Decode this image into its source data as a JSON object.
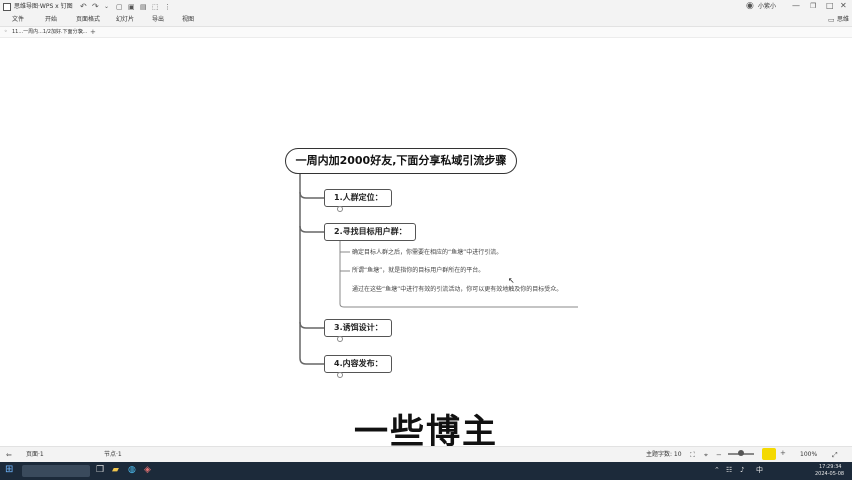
{
  "titlebar": {
    "app_title": "思维导图·WPS x 钉图",
    "user_name": "小紫小",
    "undo_icon": "undo-icon",
    "redo_icon": "redo-icon"
  },
  "menubar": {
    "items": [
      "文件",
      "开始",
      "页面格式",
      "幻灯片",
      "导出",
      "视图"
    ],
    "right_label": "思维"
  },
  "tabbar": {
    "tab_label": "11...一周内...1/2加好.下面分享...",
    "add_icon": "plus-icon"
  },
  "mindmap": {
    "root": "一周内加2000好友,下面分享私域引流步骤",
    "branches": [
      {
        "label": "1.人群定位：",
        "children": []
      },
      {
        "label": "2.寻找目标用户群：",
        "children": [
          "确定目标人群之后，你需要在相应的“鱼塘”中进行引流。",
          "所谓“鱼塘”，就是指你的目标用户群所在的平台。",
          "通过在这些“鱼塘”中进行有效的引流活动，你可以更有效地触及你的目标受众。"
        ]
      },
      {
        "label": "3.诱饵设计：",
        "children": []
      },
      {
        "label": "4.内容发布：",
        "children": []
      }
    ]
  },
  "subtitle": "一些博主",
  "statusbar": {
    "page_label": "页面·1",
    "node_count": "节点·1",
    "zoom_label": "主题字数: 10",
    "zoom_percent": "100%"
  },
  "taskbar": {
    "time": "17:29:34",
    "date": "2024-05-08",
    "ime": "中",
    "sound_icon": "speaker-icon",
    "network_icon": "network-icon"
  },
  "colors": {
    "background": "#ffffff",
    "node_border": "#555555",
    "line": "#666666",
    "taskbar": "#1c2a3a"
  }
}
